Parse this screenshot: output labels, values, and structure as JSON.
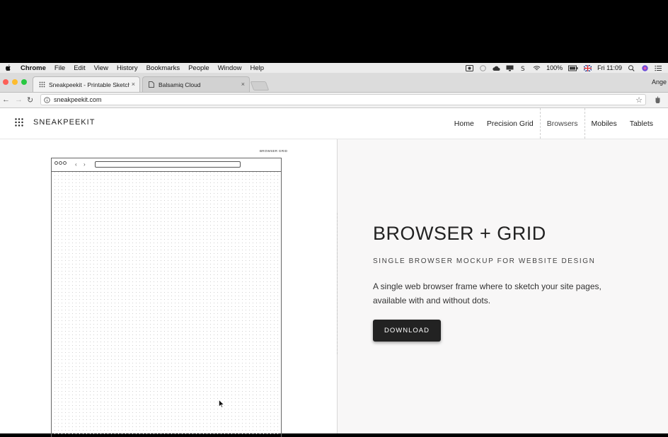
{
  "menubar": {
    "app": "Chrome",
    "items": [
      "File",
      "Edit",
      "View",
      "History",
      "Bookmarks",
      "People",
      "Window",
      "Help"
    ],
    "battery": "100%",
    "clock": "Fri 11:09"
  },
  "tabs": [
    {
      "title": "Sneakpeekit - Printable Sketch",
      "close": "×"
    },
    {
      "title": "Balsamiq Cloud",
      "close": "×"
    }
  ],
  "profile_label": "Ange",
  "address": {
    "url": "sneakpeekit.com"
  },
  "site": {
    "logo": "SNEAKPEEKIT",
    "nav": [
      "Home",
      "Precision Grid",
      "Browsers",
      "Mobiles",
      "Tablets"
    ],
    "active_nav": "Browsers"
  },
  "mockup": {
    "label": "BROWSER GRID"
  },
  "hero": {
    "title": "BROWSER + GRID",
    "subtitle": "SINGLE BROWSER MOCKUP FOR WEBSITE DESIGN",
    "description": "A single web browser frame where to sketch your site pages, available with and without dots.",
    "button": "DOWNLOAD"
  },
  "colors": {
    "button_bg": "#222222",
    "right_panel_bg": "#f8f7f7"
  }
}
